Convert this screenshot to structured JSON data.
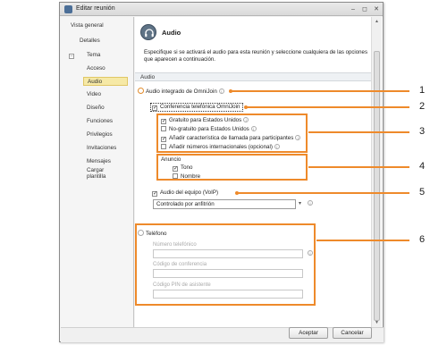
{
  "window": {
    "title": "Editar reunión",
    "controls": [
      "–",
      "◻",
      "✕"
    ]
  },
  "sidebar": {
    "items": [
      {
        "label": "Vista general"
      },
      {
        "label": "Detalles",
        "expander": "–"
      },
      {
        "label": "Tema"
      },
      {
        "label": "Acceso"
      },
      {
        "label": "Audio",
        "active": true
      },
      {
        "label": "Video"
      },
      {
        "label": "Diseño"
      },
      {
        "label": "Funciones"
      },
      {
        "label": "Privilegios"
      },
      {
        "label": "Invitaciones"
      },
      {
        "label": "Mensajes"
      },
      {
        "label": "Cargar plantilla"
      }
    ]
  },
  "content": {
    "title": "Audio",
    "description": "Especifique si se activará el audio para esta reunión y seleccione cualquiera de las opciones que aparecen a continuación.",
    "section": "Audio",
    "integrated_audio": {
      "label": "Audio integrado de OmniJoin",
      "selected": true
    },
    "conference": {
      "label": "Conferencia telefónica OmniJoin",
      "checked": true
    },
    "free_us": {
      "label": "Gratuito para Estados Unidos",
      "checked": true
    },
    "nonfree_us": {
      "label": "No-gratuito para Estados Unidos",
      "checked": false
    },
    "caller_feature": {
      "label": "Añadir característica de llamada para participantes",
      "checked": true
    },
    "intl_numbers": {
      "label": "Añadir números internacionales (opcional)",
      "checked": false
    },
    "announcement": {
      "label": "Anuncio",
      "tone": {
        "label": "Tono",
        "checked": true
      },
      "name": {
        "label": "Nombre",
        "checked": false
      }
    },
    "voip": {
      "label": "Audio del equipo (VoIP)",
      "checked": true
    },
    "voip_control": {
      "value": "Controlado por anfitrión"
    },
    "phone": {
      "label": "Teléfono",
      "selected": false
    },
    "phone_number": {
      "label": "Número telefónico",
      "value": ""
    },
    "conference_code": {
      "label": "Código de conferencia",
      "value": ""
    },
    "attendee_pin": {
      "label": "Código PIN de asistente",
      "value": ""
    }
  },
  "buttons": {
    "accept": "Aceptar",
    "cancel": "Cancelar"
  },
  "callouts": [
    "1",
    "2",
    "3",
    "4",
    "5",
    "6"
  ],
  "colors": {
    "callout": "#ee8a2b",
    "active_nav": "#f6e9a6"
  }
}
